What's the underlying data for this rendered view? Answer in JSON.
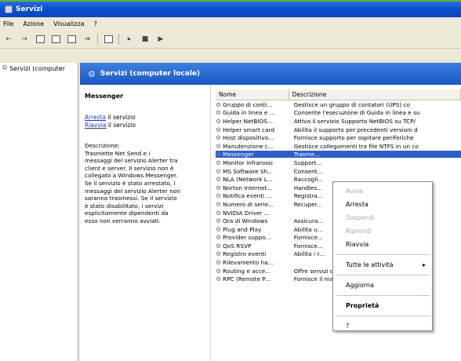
{
  "window": {
    "title": "Servizi"
  },
  "menu": [
    "File",
    "Azione",
    "Visualizza",
    "?"
  ],
  "toolbar": {
    "icons": [
      "back-icon",
      "forward-icon",
      "console-tree-icon",
      "properties-icon",
      "refresh-icon",
      "export-icon",
      "help-icon",
      "start-icon",
      "stop-icon",
      "play-icon"
    ]
  },
  "tree": {
    "root_label": "Servizi (computer"
  },
  "panel": {
    "title": "Servizi (computer locale)"
  },
  "detail": {
    "service_name": "Messenger",
    "stop_link": "Arresta",
    "stop_suffix": " il servizio",
    "restart_link": "Riavvia",
    "restart_suffix": " il servizio",
    "desc_lines": [
      "Descrizione:",
      "Trasmette Net Send e i",
      "messaggi del servizio Alerter tra",
      "client e server. Il servizio non è",
      "collegato a Windows Messenger.",
      "Se il servizio è stato arrestato, i",
      "messaggi del servizio Alerter non",
      "saranno trasmessi. Se il servizio",
      "è stato disabilitato, i servizi",
      "esplicitamente dipendenti da",
      "esso non verranno avviati."
    ]
  },
  "columns": {
    "name": "Nome",
    "description": "Descrizione"
  },
  "rows": [
    {
      "name": "Gruppo di conti...",
      "desc": "Gestisce un gruppo di contatori (UPS) co"
    },
    {
      "name": "Guida in linea e ...",
      "desc": "Consente l'esecuzione di Guida in linea e su"
    },
    {
      "name": "Helper NetBIOS...",
      "desc": "Attiva il servizio Supporto NetBIOS su TCP/"
    },
    {
      "name": "Helper smart card",
      "desc": "Abilita il supporto per precedenti versioni d"
    },
    {
      "name": "Host dispositivo...",
      "desc": "Fornisce supporto per ospitare periferiche"
    },
    {
      "name": "Manutenzione c...",
      "desc": "Gestisce collegamenti tra file NTFS in un co"
    },
    {
      "name": "Messenger",
      "desc": "Trasme..."
    },
    {
      "name": "Monitor infrarossi",
      "desc": "Support..."
    },
    {
      "name": "MS Software Sh...",
      "desc": "Consent..."
    },
    {
      "name": "NLA (Network L...",
      "desc": "Raccogli..."
    },
    {
      "name": "Norton Internet...",
      "desc": "Handles..."
    },
    {
      "name": "Notifica eventi ...",
      "desc": "Registra..."
    },
    {
      "name": "Numero di serie...",
      "desc": "Recuper..."
    },
    {
      "name": "NVIDIA Driver ...",
      "desc": ""
    },
    {
      "name": "Ora di Windows",
      "desc": "Assicura..."
    },
    {
      "name": "Plug and Play",
      "desc": "Abilita u..."
    },
    {
      "name": "Provider suppo...",
      "desc": "Fornisce..."
    },
    {
      "name": "QoS RSVP",
      "desc": "Fornisce..."
    },
    {
      "name": "Registro eventi",
      "desc": "Abilita i r..."
    },
    {
      "name": "Rilevamento ha...",
      "desc": ""
    },
    {
      "name": "Routing e acce...",
      "desc": "Offre servizi di routing ad aziende in ambien"
    },
    {
      "name": "RPC (Remote P...",
      "desc": "Fornisce il mapper dell'endpoint e altri serv"
    }
  ],
  "selected_row": "Messenger",
  "context_menu": {
    "items": [
      {
        "label": "Avvia",
        "disabled": true
      },
      {
        "label": "Arresta",
        "disabled": false
      },
      {
        "label": "Sospendi",
        "disabled": true
      },
      {
        "label": "Riprendi",
        "disabled": true
      },
      {
        "label": "Riavvia",
        "disabled": false
      },
      {
        "sep": true
      },
      {
        "label": "Tutte le attività",
        "submenu": true
      },
      {
        "sep": true
      },
      {
        "label": "Aggiorna",
        "disabled": false
      },
      {
        "sep": true
      },
      {
        "label": "Proprietà",
        "bold": true
      },
      {
        "sep": true
      },
      {
        "label": "?",
        "disabled": false
      }
    ],
    "submenu_arrow": "▸"
  },
  "colors": {
    "titlebar": "#0a4fd1",
    "selection": "#2f5fc4",
    "link": "#1c3fae"
  }
}
